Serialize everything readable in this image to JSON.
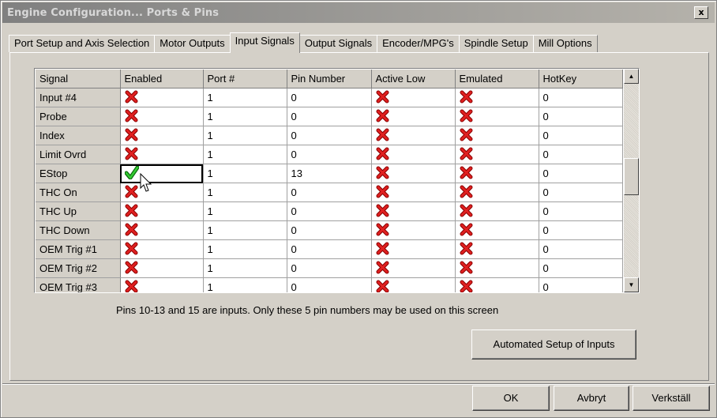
{
  "window": {
    "title": "Engine Configuration... Ports & Pins",
    "close_label": "x"
  },
  "tabs": [
    {
      "label": "Port Setup and Axis Selection"
    },
    {
      "label": "Motor Outputs"
    },
    {
      "label": "Input Signals"
    },
    {
      "label": "Output Signals"
    },
    {
      "label": "Encoder/MPG's"
    },
    {
      "label": "Spindle Setup"
    },
    {
      "label": "Mill Options"
    }
  ],
  "active_tab": "Input Signals",
  "table": {
    "columns": [
      "Signal",
      "Enabled",
      "Port #",
      "Pin Number",
      "Active Low",
      "Emulated",
      "HotKey"
    ],
    "rows": [
      {
        "signal": "Input #4",
        "enabled": false,
        "port": "1",
        "pin": "0",
        "active_low": false,
        "emulated": false,
        "hotkey": "0"
      },
      {
        "signal": "Probe",
        "enabled": false,
        "port": "1",
        "pin": "0",
        "active_low": false,
        "emulated": false,
        "hotkey": "0"
      },
      {
        "signal": "Index",
        "enabled": false,
        "port": "1",
        "pin": "0",
        "active_low": false,
        "emulated": false,
        "hotkey": "0"
      },
      {
        "signal": "Limit Ovrd",
        "enabled": false,
        "port": "1",
        "pin": "0",
        "active_low": false,
        "emulated": false,
        "hotkey": "0"
      },
      {
        "signal": "EStop",
        "enabled": true,
        "port": "1",
        "pin": "13",
        "active_low": false,
        "emulated": false,
        "hotkey": "0"
      },
      {
        "signal": "THC On",
        "enabled": false,
        "port": "1",
        "pin": "0",
        "active_low": false,
        "emulated": false,
        "hotkey": "0"
      },
      {
        "signal": "THC Up",
        "enabled": false,
        "port": "1",
        "pin": "0",
        "active_low": false,
        "emulated": false,
        "hotkey": "0"
      },
      {
        "signal": "THC Down",
        "enabled": false,
        "port": "1",
        "pin": "0",
        "active_low": false,
        "emulated": false,
        "hotkey": "0"
      },
      {
        "signal": "OEM Trig #1",
        "enabled": false,
        "port": "1",
        "pin": "0",
        "active_low": false,
        "emulated": false,
        "hotkey": "0"
      },
      {
        "signal": "OEM Trig #2",
        "enabled": false,
        "port": "1",
        "pin": "0",
        "active_low": false,
        "emulated": false,
        "hotkey": "0"
      },
      {
        "signal": "OEM Trig #3",
        "enabled": false,
        "port": "1",
        "pin": "0",
        "active_low": false,
        "emulated": false,
        "hotkey": "0"
      }
    ],
    "selected_cell": {
      "row": 4,
      "column": "Enabled"
    }
  },
  "info_text": "Pins 10-13 and 15 are inputs. Only these 5 pin numbers may be used on this screen",
  "buttons": {
    "automated_setup": "Automated Setup of Inputs",
    "ok": "OK",
    "cancel": "Avbryt",
    "apply": "Verkställ"
  },
  "icons": {
    "enabled": "green-check-icon",
    "disabled": "red-x-icon"
  },
  "colors": {
    "check": "#22aa22",
    "cross": "#cc0000",
    "titlebar_start": "#808080",
    "titlebar_end": "#b5b2ab"
  }
}
